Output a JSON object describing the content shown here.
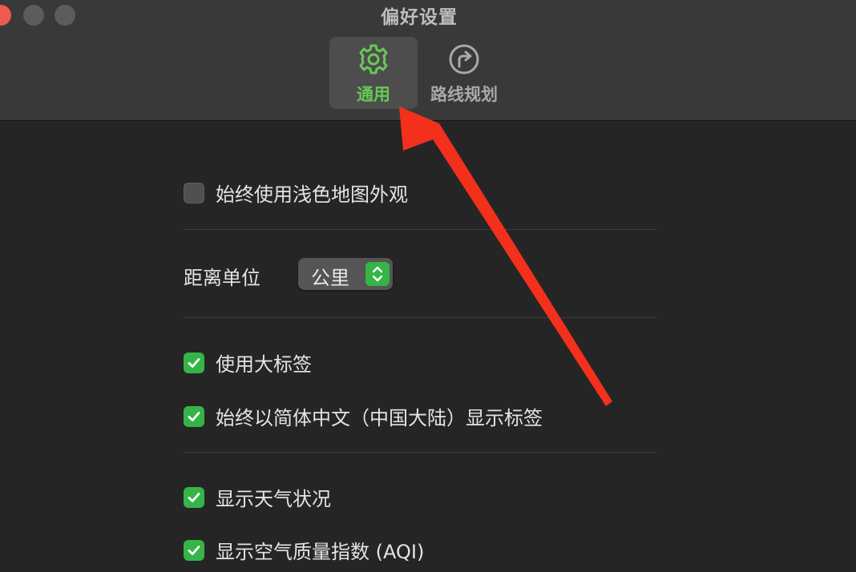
{
  "window": {
    "title": "偏好设置"
  },
  "toolbar": {
    "tabs": [
      {
        "label": "通用",
        "icon": "gear-icon",
        "selected": true,
        "color": "#67c955"
      },
      {
        "label": "路线规划",
        "icon": "route-arrow-icon",
        "selected": false
      }
    ]
  },
  "settings": {
    "light_map": {
      "label": "始终使用浅色地图外观",
      "checked": false
    },
    "distance_unit": {
      "label": "距离单位",
      "value": "公里"
    },
    "large_labels": {
      "label": "使用大标签",
      "checked": true
    },
    "simplified_chinese": {
      "label": "始终以简体中文（中国大陆）显示标签",
      "checked": true
    },
    "weather": {
      "label": "显示天气状况",
      "checked": true
    },
    "aqi": {
      "label": "显示空气质量指数 (AQI)",
      "checked": true
    }
  },
  "colors": {
    "accent": "#35b548",
    "annotation_arrow": "#f2301c"
  }
}
